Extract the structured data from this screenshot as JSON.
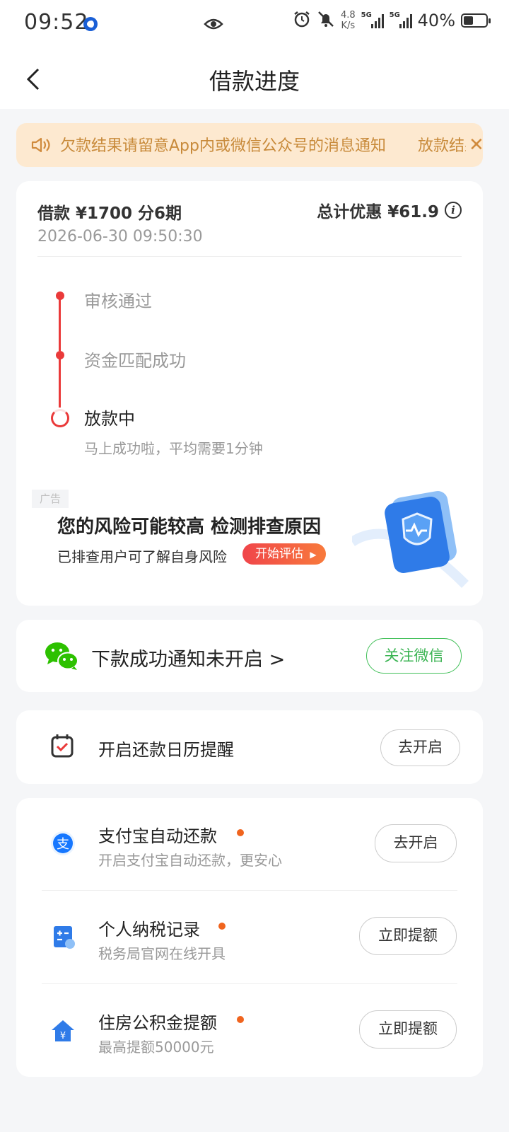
{
  "status_bar": {
    "time": "09:52",
    "speed_value": "4.8",
    "speed_unit": "K/s",
    "network_1": "5G",
    "network_2": "5G",
    "battery": "40%"
  },
  "header": {
    "title": "借款进度"
  },
  "notice": {
    "text": "欠款结果请留意App内或微信公众号的消息通知",
    "text_tail": "放款结果"
  },
  "loan": {
    "summary": "借款 ¥1700  分6期",
    "discount_label": "总计优惠 ¥61.9",
    "time": "2026-06-30 09:50:30",
    "steps": [
      {
        "label": "审核通过"
      },
      {
        "label": "资金匹配成功"
      },
      {
        "label": "放款中",
        "sub": "马上成功啦，平均需要1分钟"
      }
    ]
  },
  "ad": {
    "tag": "广告",
    "title": "您的风险可能较高 检测排查原因",
    "subtitle": "已排查用户可了解自身风险",
    "button": "开始评估"
  },
  "wechat": {
    "text": "下款成功通知未开启 >",
    "button": "关注微信"
  },
  "calendar": {
    "title": "开启还款日历提醒",
    "button": "去开启"
  },
  "services": [
    {
      "title": "支付宝自动还款",
      "sub": "开启支付宝自动还款，更安心",
      "button": "去开启"
    },
    {
      "title": "个人纳税记录",
      "sub": "税务局官网在线开具",
      "button": "立即提额"
    },
    {
      "title": "住房公积金提额",
      "sub": "最高提额50000元",
      "button": "立即提额"
    }
  ],
  "colors": {
    "accent_red": "#ea3a3a",
    "wechat_green": "#43c05a",
    "notice_bg": "#fde9d0",
    "notice_text": "#c88a3a",
    "dot_orange": "#f0641e"
  }
}
